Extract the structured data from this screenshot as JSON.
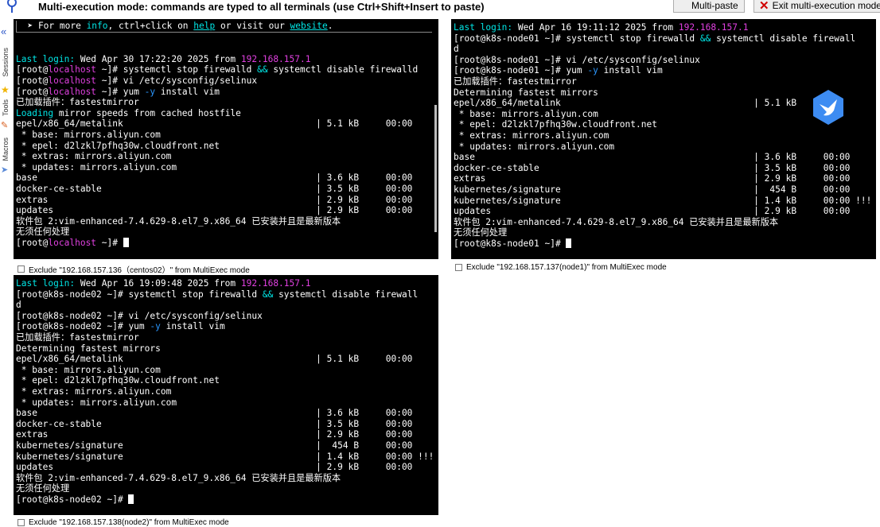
{
  "toolbar": {
    "banner": "Multi-execution mode: commands are typed to all terminals (use Ctrl+Shift+Insert to paste)",
    "multipaste_label": "Multi-paste",
    "exit_label": "Exit multi-execution mode"
  },
  "sidebar": {
    "sessions": "Sessions",
    "tools": "Tools",
    "macros": "Macros"
  },
  "term1": {
    "info": {
      "pre": "  ➤ For more ",
      "info": "info",
      "mid": ", ctrl+click on ",
      "help": "help",
      "mid2": " or visit our ",
      "website": "website",
      "end": "."
    },
    "last_login_label": "Last login:",
    "last_login_text": " Wed Apr 30 17:22:20 2025 from ",
    "last_login_ip": "192.168.157.1",
    "host": "localhost",
    "cmd1a": " ~]# systemctl stop firewalld ",
    "cmd1b": " systemctl disable firewalld",
    "amp": "&&",
    "cmd2": " ~]# vi /etc/sysconfig/selinux",
    "cmd3a": " ~]# yum ",
    "cmd3flag": "-y",
    "cmd3b": " install vim",
    "plugin": "已加载插件：fastestmirror",
    "loading_word": "Loading",
    "loading_rest": " mirror speeds from cached hostfile",
    "rows_a": [
      "epel/x86_64/metalink                                    | 5.1 kB     00:00",
      " * base: mirrors.aliyun.com",
      " * epel: d2lzkl7pfhq30w.cloudfront.net",
      " * extras: mirrors.aliyun.com",
      " * updates: mirrors.aliyun.com",
      "base                                                    | 3.6 kB     00:00",
      "docker-ce-stable                                        | 3.5 kB     00:00",
      "extras                                                  | 2.9 kB     00:00",
      "updates                                                 | 2.9 kB     00:00",
      "软件包 2:vim-enhanced-7.4.629-8.el7_9.x86_64 已安装并且是最新版本",
      "无须任何处理"
    ],
    "prompt_end": " ~]# "
  },
  "term2": {
    "last_login_label": "Last login:",
    "last_login_text": " Wed Apr 16 19:11:12 2025 from ",
    "last_login_ip": "192.168.157.1",
    "cmd1_a": "[root@k8s-node01 ~]# systemctl stop firewalld ",
    "amp": "&&",
    "cmd1_b": " systemctl disable firewall",
    "cmd1_wrap": "d",
    "cmd2": "[root@k8s-node01 ~]# vi /etc/sysconfig/selinux",
    "cmd3a": "[root@k8s-node01 ~]# yum ",
    "cmd3flag": "-y",
    "cmd3b": " install vim",
    "rows": [
      "已加载插件：fastestmirror",
      "Determining fastest mirrors",
      "epel/x86_64/metalink                                    | 5.1 kB",
      " * base: mirrors.aliyun.com",
      " * epel: d2lzkl7pfhq30w.cloudfront.net",
      " * extras: mirrors.aliyun.com",
      " * updates: mirrors.aliyun.com",
      "base                                                    | 3.6 kB     00:00",
      "docker-ce-stable                                        | 3.5 kB     00:00",
      "extras                                                  | 2.9 kB     00:00",
      "kubernetes/signature                                    |  454 B     00:00",
      "kubernetes/signature                                    | 1.4 kB     00:00 !!!",
      "updates                                                 | 2.9 kB     00:00",
      "软件包 2:vim-enhanced-7.4.629-8.el7_9.x86_64 已安装并且是最新版本",
      "无须任何处理"
    ],
    "prompt": "[root@k8s-node01 ~]# "
  },
  "term3": {
    "last_login_label": "Last login:",
    "last_login_text": " Wed Apr 16 19:09:48 2025 from ",
    "last_login_ip": "192.168.157.1",
    "cmd1_a": "[root@k8s-node02 ~]# systemctl stop firewalld ",
    "amp": "&&",
    "cmd1_b": " systemctl disable firewall",
    "cmd1_wrap": "d",
    "cmd2": "[root@k8s-node02 ~]# vi /etc/sysconfig/selinux",
    "cmd3a": "[root@k8s-node02 ~]# yum ",
    "cmd3flag": "-y",
    "cmd3b": " install vim",
    "rows": [
      "已加载插件：fastestmirror",
      "Determining fastest mirrors",
      "epel/x86_64/metalink                                    | 5.1 kB     00:00",
      " * base: mirrors.aliyun.com",
      " * epel: d2lzkl7pfhq30w.cloudfront.net",
      " * extras: mirrors.aliyun.com",
      " * updates: mirrors.aliyun.com",
      "base                                                    | 3.6 kB     00:00",
      "docker-ce-stable                                        | 3.5 kB     00:00",
      "extras                                                  | 2.9 kB     00:00",
      "kubernetes/signature                                    |  454 B     00:00",
      "kubernetes/signature                                    | 1.4 kB     00:00 !!!",
      "updates                                                 | 2.9 kB     00:00",
      "软件包 2:vim-enhanced-7.4.629-8.el7_9.x86_64 已安装并且是最新版本",
      "无须任何处理"
    ],
    "prompt": "[root@k8s-node02 ~]# "
  },
  "exclude": {
    "t1": "Exclude \"192.168.157.136（centos02）\" from MultiExec mode",
    "t2": "Exclude \"192.168.157.137(node1)\" from MultiExec mode",
    "t3": "Exclude \"192.168.157.138(node2)\" from MultiExec mode"
  },
  "colors": {
    "terminal_bg": "#000000",
    "cyan": "#00e5e5",
    "magenta": "#e040e0",
    "blue": "#2c98ff",
    "exit_x": "#d00000"
  }
}
